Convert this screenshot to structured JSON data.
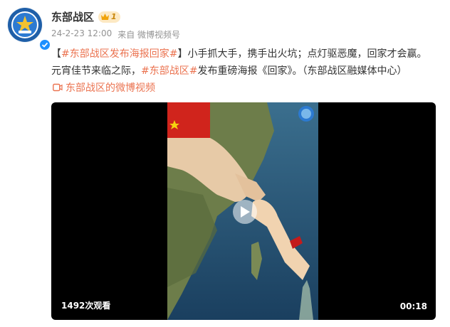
{
  "author": {
    "name": "东部战区",
    "badge_level": "1",
    "avatar_icon": "eastern-theater-emblem",
    "verified_icon": "verified-check"
  },
  "meta": {
    "timestamp": "24-2-23 12:00",
    "source": "来自 微博视频号"
  },
  "post": {
    "bracket_open": "【",
    "topic_1": "#东部战区发布海报回家#",
    "bracket_close": "】",
    "text_1": "小手抓大手，携手出火坑；点灯驱恶魔，回家才会赢。元宵佳节来临之际，",
    "topic_2": "#东部战区#",
    "text_2": "发布重磅海报《回家》。（东部战区融媒体中心）",
    "video_link_label": "东部战区的微博视频"
  },
  "video": {
    "views": "1492次观看",
    "duration": "00:18"
  },
  "colors": {
    "topic": "#eb7350",
    "text": "#333333",
    "meta": "#939393",
    "badge_bg": "#fde9c3",
    "video_bg": "#000000"
  }
}
